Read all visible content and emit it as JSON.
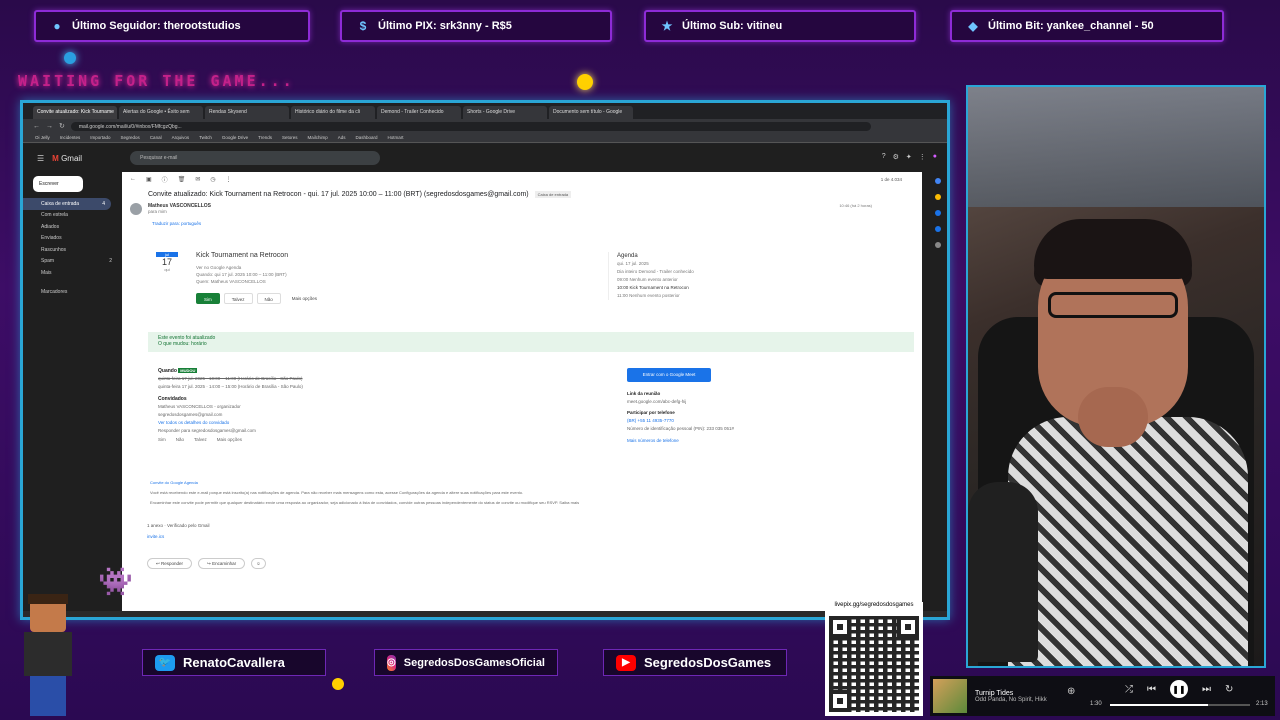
{
  "alerts": [
    {
      "icon": "person-icon",
      "text": "Último Seguidor: therootstudios"
    },
    {
      "icon": "dollar-icon",
      "text": "Último PIX: srk3nny - R$5"
    },
    {
      "icon": "star-icon",
      "text": "Último Sub: vitineu"
    },
    {
      "icon": "diamond-icon",
      "text": "Último Bit: yankee_channel - 50"
    }
  ],
  "waiting_text": "WAITING FOR THE GAME...",
  "browser": {
    "tabs": [
      "Convite atualizado: Kick Tourname",
      "Alertas do Google • Êxito sem",
      "Rendas Skysend",
      "Histórico diário do filme da cli",
      "Demond - Trailer Conhecido",
      "Shorts - Google Drive",
      "Documento sem título - Google"
    ],
    "url": "mail.google.com/mail/u/0/#inbox/FMfcgzQbg...",
    "bookmarks": [
      "Oi Jelly",
      "Incidentes",
      "Importado",
      "Segredos",
      "Canal",
      "Arquivos",
      "Twitch",
      "Google Drive",
      "Trends",
      "Setores",
      "Mailchimp",
      "Ads",
      "Dashboard",
      "Hotmart"
    ]
  },
  "gmail": {
    "logo": "Gmail",
    "search_placeholder": "Pesquisar e-mail",
    "compose": "Escrever",
    "nav": [
      {
        "label": "Caixa de entrada",
        "count": "4"
      },
      {
        "label": "Com estrela",
        "count": ""
      },
      {
        "label": "Adiados",
        "count": ""
      },
      {
        "label": "Enviados",
        "count": ""
      },
      {
        "label": "Rascunhos",
        "count": ""
      },
      {
        "label": "Spam",
        "count": "2"
      },
      {
        "label": "Mais",
        "count": ""
      }
    ],
    "labels_heading": "Marcadores",
    "pager": "1 de 4.034",
    "subject": "Convite atualizado: Kick Tournament na Retrocon - qui. 17 jul. 2025 10:00 – 11:00 (BRT) (segredosdosgames@gmail.com)",
    "subject_tag": "Caixa de entrada",
    "sender": "Matheus VASCONCELLOS",
    "sender_to": "para mim",
    "date": "10:46 (há 2 horas)",
    "translate": "Traduzir para: português",
    "event": {
      "month": "jul",
      "day": "17",
      "weekday": "qui",
      "title": "Kick Tournament na Retrocon",
      "lines": [
        "Ver no Google Agenda",
        "Quando: qui 17 jul. 2025 10:00 – 11:00 (BRT)",
        "Quem: Matheus VASCONCELLOS"
      ],
      "rsvp": [
        "Sim",
        "Talvez",
        "Não",
        "Mais opções"
      ]
    },
    "agenda": {
      "title": "Agenda",
      "lines": [
        "qui. 17 jul. 2025",
        "Dia inteiro  Demond - Trailer conhecido",
        "09:00  Nenhum evento anterior",
        "10:00  Kick Tournament na Retrocon",
        "11:00  Nenhum evento posterior"
      ]
    },
    "updated_notice": "Este evento foi atualizado",
    "updated_sub": "O que mudou: horário",
    "details": {
      "when_label": "Quando",
      "when_badge": "MUDOU",
      "when_lines": [
        "quinta-feira 17 jul. 2025 · 10:00 – 11:00 (Horário de Brasília - São Paulo)",
        "quinta-feira 17 jul. 2025 · 14:00 – 15:00 (Horário de Brasília - São Paulo)"
      ],
      "guests_label": "Convidados",
      "guests": [
        "Matheus VASCONCELLOS - organizador",
        "segredosdosgames@gmail.com"
      ],
      "all_guests": "Ver todos os detalhes do convidado",
      "reply_label": "Responder para segredosdosgames@gmail.com",
      "reply_opts": [
        "Sim",
        "Não",
        "Talvez",
        "Mais opções"
      ]
    },
    "meet": {
      "button": "Entrar com o Google Meet",
      "link_label": "Link da reunião",
      "link": "meet.google.com/abc-defg-hij",
      "phone_label": "Participar por telefone",
      "phone": "(BR) +55 11 4935-7770",
      "pin": "Número de identificação pessoal (PIN): 233 035 051#",
      "more": "Mais números de telefone"
    },
    "footer": {
      "invite_from": "Convite do Google Agenda",
      "line1": "Você está recebendo este e-mail porque está inscrito(a) nas notificações de agenda. Para não receber mais mensagens como esta, acesse Configurações da agenda e altere suas notificações para este evento.",
      "line2": "Encaminhar este convite pode permitir que qualquer destinatário envie uma resposta ao organizador, seja adicionado à lista de convidados, convide outras pessoas independentemente do status de convite ou modifique seu RSVP. Saiba mais"
    },
    "attachment_label": "1 anexo · Verificado pelo Gmail",
    "attachment_file": "invite.ics",
    "reply_buttons": [
      "Responder",
      "Encaminhar"
    ]
  },
  "social": [
    {
      "icon": "twitter-icon",
      "text": "RenatoCavallera"
    },
    {
      "icon": "instagram-icon",
      "text": "SegredosDosGamesOficial"
    },
    {
      "icon": "youtube-icon",
      "text": "SegredosDosGames"
    }
  ],
  "qr_label": "livepix.gg/segredosdosgames",
  "player": {
    "title": "Turnip Tides",
    "artist": "Odd Panda, No Spirit, Hikk",
    "elapsed": "1:30",
    "total": "2:13",
    "progress": 0.7
  },
  "colors": {
    "background": "#2a0a4a",
    "frame_border": "#2aa6d6",
    "alert_border": "#8d2bd6",
    "waiting": "#c4218a"
  }
}
